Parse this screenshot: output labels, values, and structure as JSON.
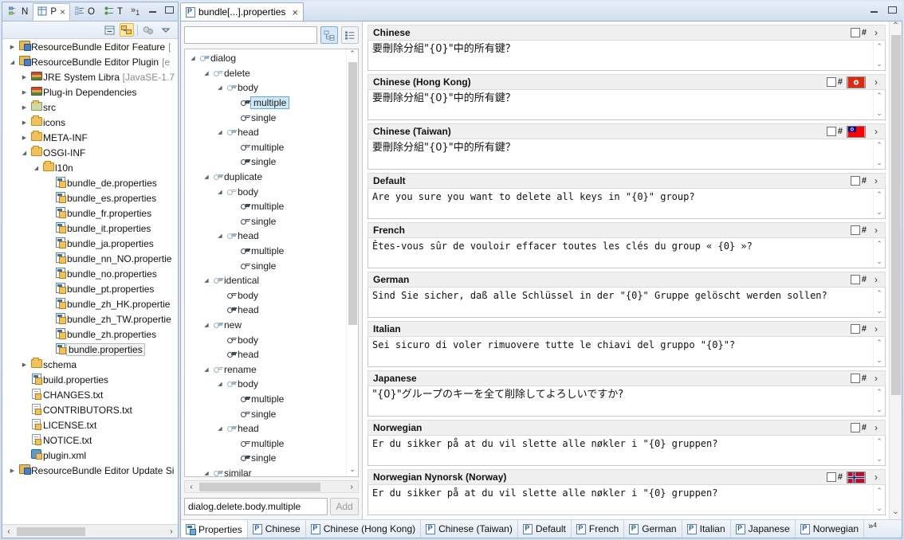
{
  "window": {
    "minimize_label": "–",
    "maximize_label": "□"
  },
  "left_view": {
    "tabs": [
      {
        "label": "N",
        "icon": "navigator-icon",
        "active": false
      },
      {
        "label": "P",
        "icon": "package-explorer-icon",
        "active": true,
        "close": "×"
      },
      {
        "label": "O",
        "icon": "outline-icon",
        "active": false
      },
      {
        "label": "T",
        "icon": "task-list-icon",
        "active": false
      }
    ],
    "more_tabs": "»",
    "more_tabs_count": "1",
    "toolbar": {
      "collapse_all": "collapse-all-icon",
      "link_with_editor": "link-with-editor-icon",
      "view_menu_filter": "filter-icon",
      "view_menu": "view-menu-icon"
    },
    "tree": [
      {
        "depth": 0,
        "arrow": "collapsed",
        "icon": "project-icon",
        "label": "ResourceBundle Editor Feature",
        "suffix": "["
      },
      {
        "depth": 0,
        "arrow": "expanded",
        "icon": "project-icon",
        "label": "ResourceBundle Editor Plugin",
        "suffix": "[e"
      },
      {
        "depth": 1,
        "arrow": "collapsed",
        "icon": "library-icon",
        "label": "JRE System Library",
        "suffix": "[JavaSE-1.7"
      },
      {
        "depth": 1,
        "arrow": "collapsed",
        "icon": "library-icon",
        "label": "Plug-in Dependencies",
        "suffix": ""
      },
      {
        "depth": 1,
        "arrow": "collapsed",
        "icon": "source-folder-icon",
        "label": "src",
        "suffix": ""
      },
      {
        "depth": 1,
        "arrow": "collapsed",
        "icon": "folder-icon",
        "label": "icons",
        "suffix": ""
      },
      {
        "depth": 1,
        "arrow": "collapsed",
        "icon": "folder-icon",
        "label": "META-INF",
        "suffix": ""
      },
      {
        "depth": 1,
        "arrow": "expanded",
        "icon": "folder-icon",
        "label": "OSGI-INF",
        "suffix": ""
      },
      {
        "depth": 2,
        "arrow": "expanded",
        "icon": "folder-icon",
        "label": "l10n",
        "suffix": ""
      },
      {
        "depth": 3,
        "arrow": "none",
        "icon": "properties-file-icon",
        "label": "bundle_de.properties",
        "suffix": ""
      },
      {
        "depth": 3,
        "arrow": "none",
        "icon": "properties-file-icon",
        "label": "bundle_es.properties",
        "suffix": ""
      },
      {
        "depth": 3,
        "arrow": "none",
        "icon": "properties-file-icon",
        "label": "bundle_fr.properties",
        "suffix": ""
      },
      {
        "depth": 3,
        "arrow": "none",
        "icon": "properties-file-icon",
        "label": "bundle_it.properties",
        "suffix": ""
      },
      {
        "depth": 3,
        "arrow": "none",
        "icon": "properties-file-icon",
        "label": "bundle_ja.properties",
        "suffix": ""
      },
      {
        "depth": 3,
        "arrow": "none",
        "icon": "properties-file-icon",
        "label": "bundle_nn_NO.propertie",
        "suffix": ""
      },
      {
        "depth": 3,
        "arrow": "none",
        "icon": "properties-file-icon",
        "label": "bundle_no.properties",
        "suffix": ""
      },
      {
        "depth": 3,
        "arrow": "none",
        "icon": "properties-file-icon",
        "label": "bundle_pt.properties",
        "suffix": ""
      },
      {
        "depth": 3,
        "arrow": "none",
        "icon": "properties-file-icon",
        "label": "bundle_zh_HK.propertie",
        "suffix": ""
      },
      {
        "depth": 3,
        "arrow": "none",
        "icon": "properties-file-icon",
        "label": "bundle_zh_TW.propertie",
        "suffix": ""
      },
      {
        "depth": 3,
        "arrow": "none",
        "icon": "properties-file-icon",
        "label": "bundle_zh.properties",
        "suffix": ""
      },
      {
        "depth": 3,
        "arrow": "none",
        "icon": "properties-file-icon",
        "label": "bundle.properties",
        "suffix": "",
        "selected": true
      },
      {
        "depth": 1,
        "arrow": "collapsed",
        "icon": "folder-icon",
        "label": "schema",
        "suffix": ""
      },
      {
        "depth": 1,
        "arrow": "none",
        "icon": "properties-file-icon",
        "label": "build.properties",
        "suffix": ""
      },
      {
        "depth": 1,
        "arrow": "none",
        "icon": "text-file-icon",
        "label": "CHANGES.txt",
        "suffix": ""
      },
      {
        "depth": 1,
        "arrow": "none",
        "icon": "text-file-icon",
        "label": "CONTRIBUTORS.txt",
        "suffix": ""
      },
      {
        "depth": 1,
        "arrow": "none",
        "icon": "text-file-icon",
        "label": "LICENSE.txt",
        "suffix": ""
      },
      {
        "depth": 1,
        "arrow": "none",
        "icon": "text-file-icon",
        "label": "NOTICE.txt",
        "suffix": ""
      },
      {
        "depth": 1,
        "arrow": "none",
        "icon": "xml-file-icon",
        "label": "plugin.xml",
        "suffix": ""
      },
      {
        "depth": 0,
        "arrow": "collapsed",
        "icon": "project-icon",
        "label": "ResourceBundle Editor Update Si",
        "suffix": ""
      }
    ],
    "hscroll": {
      "left_arrow": "‹",
      "right_arrow": "›"
    }
  },
  "editor": {
    "tab_label": "bundle[...].properties",
    "tab_close": "×"
  },
  "key_panel": {
    "filter_value": "",
    "filter_placeholder": "",
    "view_tree_button": "tree-layout-icon",
    "view_flat_button": "flat-layout-icon",
    "tree": [
      {
        "depth": 0,
        "arrow": "expanded",
        "label": "dialog",
        "dim": true
      },
      {
        "depth": 1,
        "arrow": "expanded",
        "label": "delete",
        "dim": true
      },
      {
        "depth": 2,
        "arrow": "expanded",
        "label": "body",
        "dim": true
      },
      {
        "depth": 3,
        "arrow": "none",
        "label": "multiple",
        "dim": false,
        "selected": true
      },
      {
        "depth": 3,
        "arrow": "none",
        "label": "single",
        "dim": false
      },
      {
        "depth": 2,
        "arrow": "expanded",
        "label": "head",
        "dim": true
      },
      {
        "depth": 3,
        "arrow": "none",
        "label": "multiple",
        "dim": false
      },
      {
        "depth": 3,
        "arrow": "none",
        "label": "single",
        "dim": false
      },
      {
        "depth": 1,
        "arrow": "expanded",
        "label": "duplicate",
        "dim": true
      },
      {
        "depth": 2,
        "arrow": "expanded",
        "label": "body",
        "dim": true
      },
      {
        "depth": 3,
        "arrow": "none",
        "label": "multiple",
        "dim": false
      },
      {
        "depth": 3,
        "arrow": "none",
        "label": "single",
        "dim": false
      },
      {
        "depth": 2,
        "arrow": "expanded",
        "label": "head",
        "dim": true
      },
      {
        "depth": 3,
        "arrow": "none",
        "label": "multiple",
        "dim": false
      },
      {
        "depth": 3,
        "arrow": "none",
        "label": "single",
        "dim": false
      },
      {
        "depth": 1,
        "arrow": "expanded",
        "label": "identical",
        "dim": true
      },
      {
        "depth": 2,
        "arrow": "none",
        "label": "body",
        "dim": false
      },
      {
        "depth": 2,
        "arrow": "none",
        "label": "head",
        "dim": false
      },
      {
        "depth": 1,
        "arrow": "expanded",
        "label": "new",
        "dim": true
      },
      {
        "depth": 2,
        "arrow": "none",
        "label": "body",
        "dim": false
      },
      {
        "depth": 2,
        "arrow": "none",
        "label": "head",
        "dim": false
      },
      {
        "depth": 1,
        "arrow": "expanded",
        "label": "rename",
        "dim": true
      },
      {
        "depth": 2,
        "arrow": "expanded",
        "label": "body",
        "dim": true
      },
      {
        "depth": 3,
        "arrow": "none",
        "label": "multiple",
        "dim": false
      },
      {
        "depth": 3,
        "arrow": "none",
        "label": "single",
        "dim": false
      },
      {
        "depth": 2,
        "arrow": "expanded",
        "label": "head",
        "dim": true
      },
      {
        "depth": 3,
        "arrow": "none",
        "label": "multiple",
        "dim": false
      },
      {
        "depth": 3,
        "arrow": "none",
        "label": "single",
        "dim": false
      },
      {
        "depth": 1,
        "arrow": "expanded",
        "label": "similar",
        "dim": true
      }
    ],
    "key_value": "dialog.delete.body.multiple",
    "add_label": "Add",
    "hscroll": {
      "left_arrow": "‹",
      "right_arrow": "›"
    },
    "vscroll": {
      "up": "⌃",
      "down": "⌄"
    }
  },
  "translations": [
    {
      "locale": "Chinese",
      "text": "要刪除分組\"{0}\"中的所有键？",
      "cjk": true,
      "flag": null,
      "checkbox": false,
      "hash": "#",
      "chevron": "›"
    },
    {
      "locale": "Chinese (Hong Kong)",
      "text": "要刪除分組\"{0}\"中的所有鍵？",
      "cjk": true,
      "flag": "hong-kong-flag",
      "checkbox": false,
      "hash": "#",
      "chevron": "›"
    },
    {
      "locale": "Chinese (Taiwan)",
      "text": "要刪除分組\"{0}\"中的所有鍵？",
      "cjk": true,
      "flag": "taiwan-flag",
      "checkbox": false,
      "hash": "#",
      "chevron": "›"
    },
    {
      "locale": "Default",
      "text": "Are you sure you want to delete all keys in \"{0}\" group?",
      "cjk": false,
      "flag": null,
      "checkbox": false,
      "hash": "#",
      "chevron": "›"
    },
    {
      "locale": "French",
      "text": "Êtes-vous sûr de vouloir effacer toutes les clés du group « {0} »?",
      "cjk": false,
      "flag": null,
      "checkbox": false,
      "hash": "#",
      "chevron": "›"
    },
    {
      "locale": "German",
      "text": "Sind Sie sicher, daß alle Schlüssel in der \"{0}\" Gruppe gelöscht werden sollen?",
      "cjk": false,
      "flag": null,
      "checkbox": false,
      "hash": "#",
      "chevron": "›"
    },
    {
      "locale": "Italian",
      "text": "Sei sicuro di voler rimuovere tutte le chiavi del gruppo \"{0}\"?",
      "cjk": false,
      "flag": null,
      "checkbox": false,
      "hash": "#",
      "chevron": "›"
    },
    {
      "locale": "Japanese",
      "text": "\"{0}\"グループのキーを全て削除してよろしいですか?",
      "cjk": true,
      "flag": null,
      "checkbox": false,
      "hash": "#",
      "chevron": "›"
    },
    {
      "locale": "Norwegian",
      "text": "Er du sikker på at du vil slette alle nøkler i \"{0} gruppen?",
      "cjk": false,
      "flag": null,
      "checkbox": false,
      "hash": "#",
      "chevron": "›"
    },
    {
      "locale": "Norwegian Nynorsk (Norway)",
      "text": "Er du sikker på at du vil slette alle nøkler i \"{0} gruppen?",
      "cjk": false,
      "flag": "norway-flag",
      "checkbox": false,
      "hash": "#",
      "chevron": "›"
    }
  ],
  "bottom_tabs": {
    "items": [
      {
        "label": "Properties",
        "icon": "properties-tab-icon",
        "active": true
      },
      {
        "label": "Chinese",
        "icon": "p-icon",
        "active": false
      },
      {
        "label": "Chinese (Hong Kong)",
        "icon": "p-icon",
        "active": false
      },
      {
        "label": "Chinese (Taiwan)",
        "icon": "p-icon",
        "active": false
      },
      {
        "label": "Default",
        "icon": "p-icon",
        "active": false
      },
      {
        "label": "French",
        "icon": "p-icon",
        "active": false
      },
      {
        "label": "German",
        "icon": "p-icon",
        "active": false
      },
      {
        "label": "Italian",
        "icon": "p-icon",
        "active": false
      },
      {
        "label": "Japanese",
        "icon": "p-icon",
        "active": false
      },
      {
        "label": "Norwegian",
        "icon": "p-icon",
        "active": false
      }
    ],
    "overflow": "»",
    "overflow_count": "4"
  },
  "colors": {
    "accent": "#3a6ea5",
    "selection": "#cfe8fa",
    "chrome": "#d2dfef",
    "hk_flag_red": "#de2910",
    "tw_flag_red": "#fe0000",
    "tw_flag_blue": "#000095",
    "no_flag_red": "#ba0c2f",
    "no_flag_blue": "#00205b"
  }
}
